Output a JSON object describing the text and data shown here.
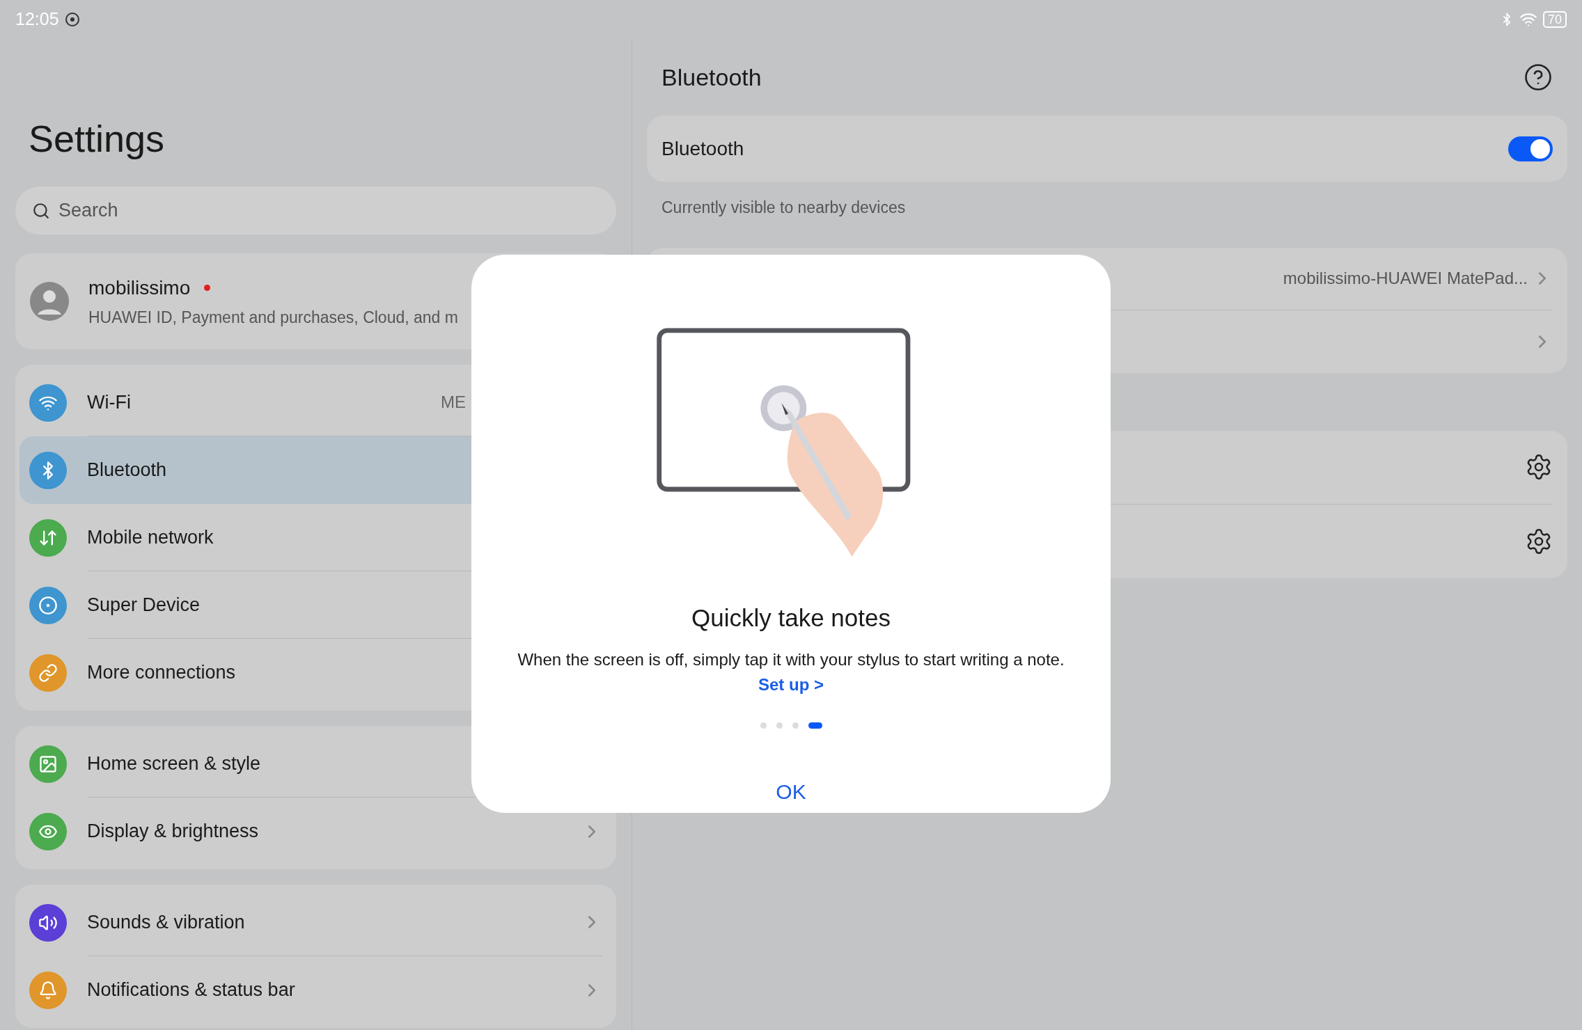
{
  "status_bar": {
    "time": "12:05",
    "battery": "70"
  },
  "sidebar": {
    "title": "Settings",
    "search": {
      "placeholder": "Search"
    },
    "account": {
      "name": "mobilissimo",
      "subtitle": "HUAWEI ID, Payment and purchases, Cloud, and m",
      "badge": true
    },
    "groups": [
      {
        "chevrons": false,
        "items": [
          {
            "kind": "wifi",
            "label": "Wi-Fi",
            "value": "ME",
            "selected": false,
            "color": "#3e95cf"
          },
          {
            "kind": "bluetooth",
            "label": "Bluetooth",
            "selected": true,
            "color": "#3e95cf"
          },
          {
            "kind": "mobile",
            "label": "Mobile network",
            "selected": false,
            "color": "#4caa4f"
          },
          {
            "kind": "superdevice",
            "label": "Super Device",
            "selected": false,
            "color": "#3e95cf"
          },
          {
            "kind": "link",
            "label": "More connections",
            "selected": false,
            "color": "#e0962a"
          }
        ]
      },
      {
        "chevrons": true,
        "items": [
          {
            "kind": "image",
            "label": "Home screen & style",
            "selected": false,
            "color": "#4caa4f"
          },
          {
            "kind": "eye",
            "label": "Display & brightness",
            "selected": false,
            "color": "#4caa4f"
          }
        ]
      },
      {
        "chevrons": true,
        "items": [
          {
            "kind": "sound",
            "label": "Sounds & vibration",
            "selected": false,
            "color": "#5b3fd6"
          },
          {
            "kind": "bell",
            "label": "Notifications & status bar",
            "selected": false,
            "color": "#e0962a"
          }
        ]
      }
    ]
  },
  "detail": {
    "title": "Bluetooth",
    "toggle": {
      "label": "Bluetooth",
      "on": true
    },
    "note": "Currently visible to nearby devices",
    "rows": [
      {
        "kind": "link",
        "value": "mobilissimo-HUAWEI MatePad..."
      },
      {
        "kind": "link"
      }
    ],
    "device_rows": [
      {
        "kind": "settings"
      },
      {
        "kind": "settings"
      }
    ]
  },
  "dialog": {
    "title": "Quickly take notes",
    "message": "When the screen is off, simply tap it with your stylus to start writing a note.",
    "link": "Set up >",
    "pages": [
      {
        "selected": false
      },
      {
        "selected": false
      },
      {
        "selected": false
      },
      {
        "selected": true
      }
    ],
    "button": "OK"
  }
}
